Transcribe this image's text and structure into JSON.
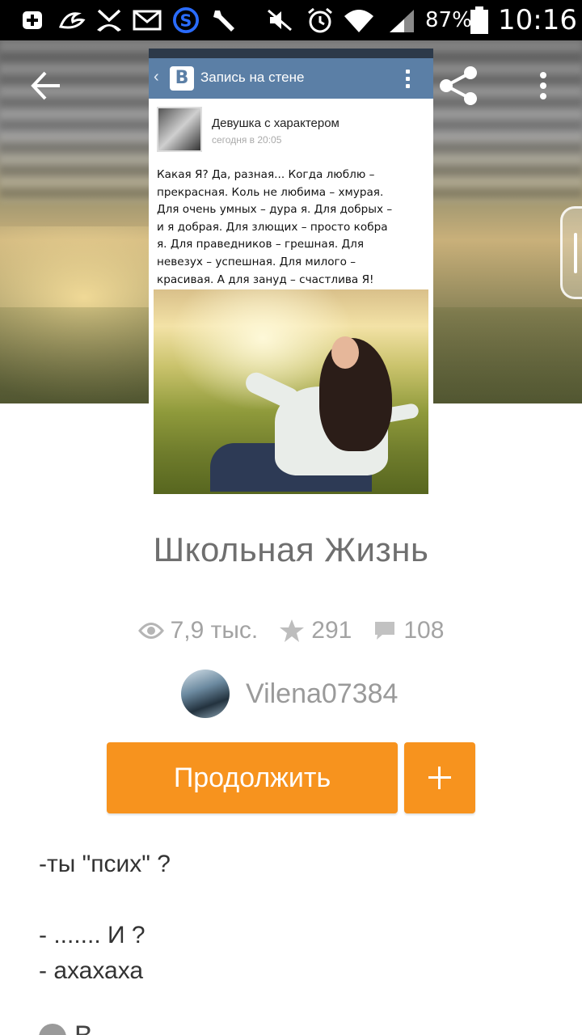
{
  "status_bar": {
    "battery_percent": "87%",
    "time": "10:16"
  },
  "toolbar": {
    "back_icon": "arrow-left-icon",
    "share_icon": "share-icon",
    "menu_icon": "more-vert-icon"
  },
  "embedded_post": {
    "header_title": "Запись на стене",
    "logo_letter": "В",
    "author": "Девушка с характером",
    "date": "сегодня в 20:05",
    "lines": [
      "Какая Я? Да, разная... Когда люблю –",
      "прекрасная. Коль не любима – хмурая.",
      "Для очень умных – дура я. Для добрых –",
      "и я добрая. Для злющих – просто кобра",
      "я. Для праведников – грешная. Для",
      "невезух – успешная. Для милого –",
      "красивая. А для зануд – счастлива Я!"
    ]
  },
  "title": "Школьная Жизнь",
  "stats": {
    "views": "7,9 тыс.",
    "stars": "291",
    "comments": "108"
  },
  "author": {
    "name": "Vilena07384"
  },
  "actions": {
    "continue_label": "Продолжить"
  },
  "body": {
    "line1": "-ты \"псих\" ?",
    "line2": "- ....... И ?",
    "line3": "- ахахаха",
    "line4": "В"
  },
  "colors": {
    "accent": "#f7931e",
    "muted_text": "#a3a3a3",
    "title_text": "#6f6f6f"
  }
}
